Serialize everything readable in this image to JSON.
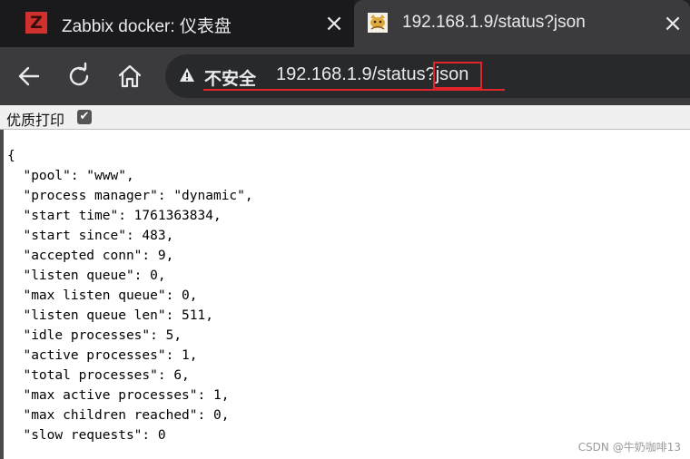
{
  "tabs": [
    {
      "title": "Zabbix docker: 仪表盘",
      "icon": "zabbix-logo-icon",
      "active": false
    },
    {
      "title": "192.168.1.9/status?json",
      "icon": "tomcat-cat-icon",
      "active": true
    }
  ],
  "close_glyph": "×",
  "zabbix_letter": "Z",
  "address_bar": {
    "security_label": "不安全",
    "url": "192.168.1.9/status?json"
  },
  "pretty_print": {
    "label": "优质打印",
    "checked": true,
    "check_glyph": "✔"
  },
  "json_lines": [
    "{",
    "  \"pool\": \"www\",",
    "  \"process manager\": \"dynamic\",",
    "  \"start time\": 1761363834,",
    "  \"start since\": 483,",
    "  \"accepted conn\": 9,",
    "  \"listen queue\": 0,",
    "  \"max listen queue\": 0,",
    "  \"listen queue len\": 511,",
    "  \"idle processes\": 5,",
    "  \"active processes\": 1,",
    "  \"total processes\": 6,",
    "  \"max active processes\": 1,",
    "  \"max children reached\": 0,",
    "  \"slow requests\": 0"
  ],
  "watermark": "CSDN @牛奶咖啡13",
  "colors": {
    "annotation": "#e0242a",
    "tab_active": "#3b3b3d",
    "tab_inactive": "#1a1a1c",
    "zabbix_brand": "#d0312d"
  }
}
